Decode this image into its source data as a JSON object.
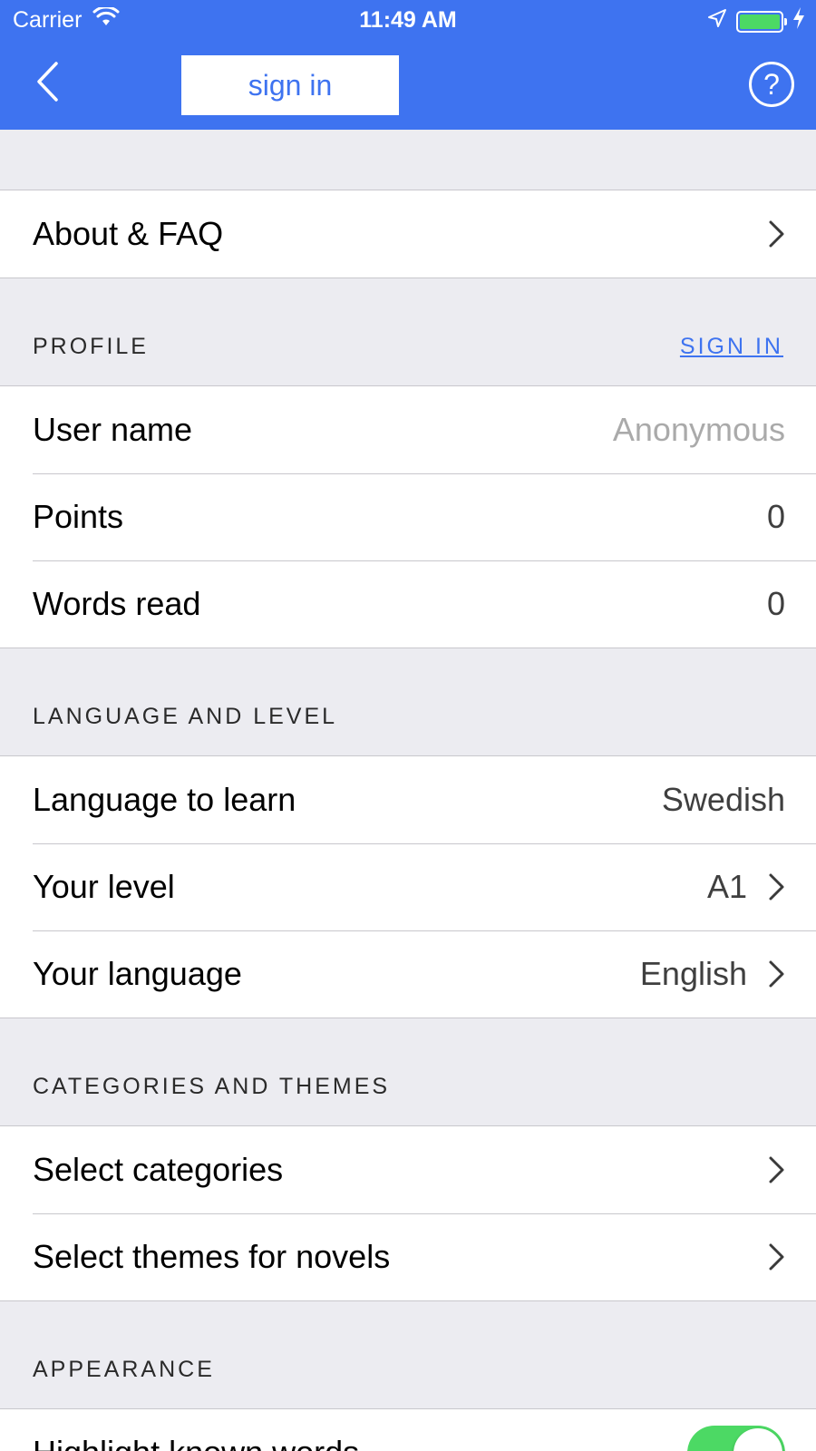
{
  "status_bar": {
    "carrier": "Carrier",
    "time": "11:49 AM",
    "battery_color": "#4cd964"
  },
  "nav": {
    "back_icon": "chevron-left-icon",
    "sign_in_label": "sign in",
    "help_icon": "question-circle-icon",
    "help_symbol": "?"
  },
  "colors": {
    "accent": "#3e73f0",
    "background": "#ececf1",
    "toggle_on": "#4cd964"
  },
  "about": {
    "label": "About & FAQ"
  },
  "profile": {
    "header": "PROFILE",
    "action": "SIGN IN",
    "rows": [
      {
        "label": "User name",
        "value": "Anonymous"
      },
      {
        "label": "Points",
        "value": "0"
      },
      {
        "label": "Words read",
        "value": "0"
      }
    ]
  },
  "language": {
    "header": "LANGUAGE AND LEVEL",
    "rows": [
      {
        "label": "Language to learn",
        "value": "Swedish"
      },
      {
        "label": "Your level",
        "value": "A1"
      },
      {
        "label": "Your language",
        "value": "English"
      }
    ]
  },
  "categories": {
    "header": "CATEGORIES AND THEMES",
    "rows": [
      {
        "label": "Select categories"
      },
      {
        "label": "Select themes for novels"
      }
    ]
  },
  "appearance": {
    "header": "APPEARANCE",
    "rows": [
      {
        "label": "Highlight known words",
        "toggle_on": true
      }
    ]
  }
}
